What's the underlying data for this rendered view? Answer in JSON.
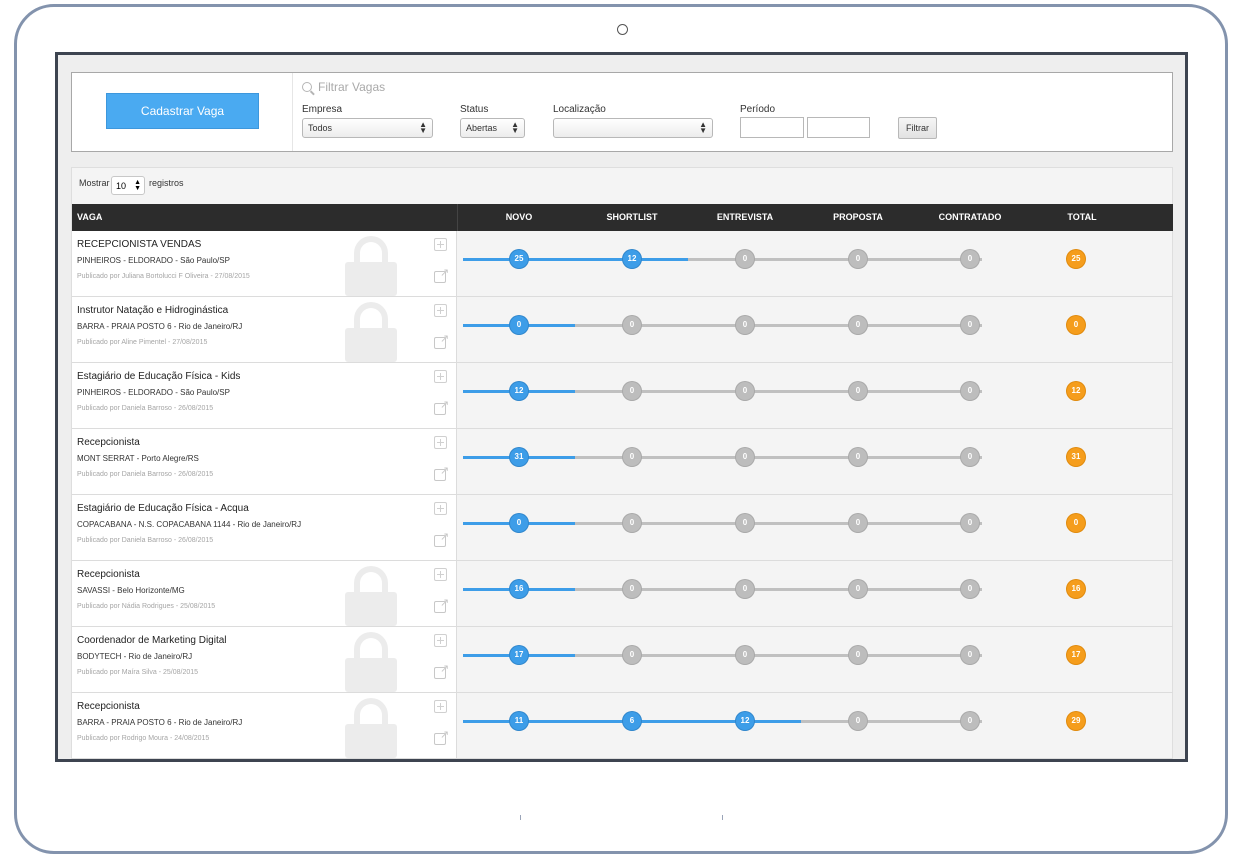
{
  "header": {
    "cadastrar_label": "Cadastrar Vaga",
    "filter_title": "Filtrar Vagas",
    "empresa_label": "Empresa",
    "empresa_value": "Todos",
    "status_label": "Status",
    "status_value": "Abertas",
    "localizacao_label": "Localização",
    "localizacao_value": "",
    "periodo_label": "Período",
    "filtrar_label": "Filtrar"
  },
  "table": {
    "mostrar_label": "Mostrar",
    "mostrar_value": "10",
    "registros_label": "registros",
    "columns": [
      "VAGA",
      "NOVO",
      "SHORTLIST",
      "ENTREVISTA",
      "PROPOSTA",
      "CONTRATADO",
      "TOTAL"
    ],
    "rows": [
      {
        "title": "RECEPCIONISTA VENDAS",
        "location": "PINHEIROS - ELDORADO - São Paulo/SP",
        "published": "Publicado por Juliana Bortolucci F Oliveira - 27/08/2015",
        "locked": true,
        "stages": [
          25,
          12,
          0,
          0,
          0
        ],
        "total": 25,
        "progress": 2
      },
      {
        "title": "Instrutor Natação e Hidroginástica",
        "location": "BARRA - PRAIA POSTO 6 - Rio de Janeiro/RJ",
        "published": "Publicado por Aline Pimentel - 27/08/2015",
        "locked": true,
        "stages": [
          0,
          0,
          0,
          0,
          0
        ],
        "total": 0,
        "progress": 1
      },
      {
        "title": "Estagiário de Educação Física - Kids",
        "location": "PINHEIROS - ELDORADO - São Paulo/SP",
        "published": "Publicado por Daniela Barroso - 26/08/2015",
        "locked": false,
        "stages": [
          12,
          0,
          0,
          0,
          0
        ],
        "total": 12,
        "progress": 1
      },
      {
        "title": "Recepcionista",
        "location": "MONT SERRAT - Porto Alegre/RS",
        "published": "Publicado por Daniela Barroso - 26/08/2015",
        "locked": false,
        "stages": [
          31,
          0,
          0,
          0,
          0
        ],
        "total": 31,
        "progress": 1
      },
      {
        "title": "Estagiário de Educação Física - Acqua",
        "location": "COPACABANA - N.S. COPACABANA 1144 - Rio de Janeiro/RJ",
        "published": "Publicado por Daniela Barroso - 26/08/2015",
        "locked": false,
        "stages": [
          0,
          0,
          0,
          0,
          0
        ],
        "total": 0,
        "progress": 1
      },
      {
        "title": "Recepcionista",
        "location": "SAVASSI - Belo Horizonte/MG",
        "published": "Publicado por Nádia Rodrigues - 25/08/2015",
        "locked": true,
        "stages": [
          16,
          0,
          0,
          0,
          0
        ],
        "total": 16,
        "progress": 1
      },
      {
        "title": "Coordenador de Marketing Digital",
        "location": "BODYTECH - Rio de Janeiro/RJ",
        "published": "Publicado por Maíra Silva - 25/08/2015",
        "locked": true,
        "stages": [
          17,
          0,
          0,
          0,
          0
        ],
        "total": 17,
        "progress": 1
      },
      {
        "title": "Recepcionista",
        "location": "BARRA - PRAIA POSTO 6 - Rio de Janeiro/RJ",
        "published": "Publicado por Rodrigo Moura - 24/08/2015",
        "locked": true,
        "stages": [
          11,
          6,
          12,
          0,
          0
        ],
        "total": 29,
        "progress": 3
      }
    ]
  },
  "colors": {
    "accent_blue": "#3d9de8",
    "inactive_gray": "#bdbdbd",
    "total_orange": "#f59d1c",
    "header_dark": "#2c2c2c"
  },
  "icons": [
    "search-icon",
    "lock-icon",
    "plus-icon",
    "external-link-icon"
  ]
}
